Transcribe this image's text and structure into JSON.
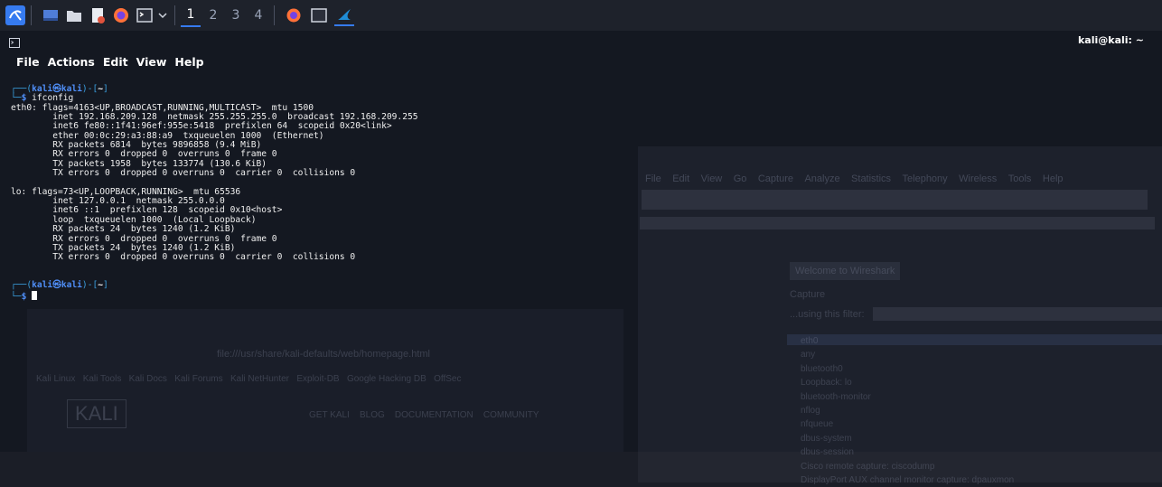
{
  "taskbar": {
    "workspaces": [
      "1",
      "2",
      "3",
      "4"
    ],
    "active_workspace": "1",
    "accent": "#367bf0"
  },
  "window": {
    "title": "kali@kali: ~"
  },
  "menu": [
    "File",
    "Actions",
    "Edit",
    "View",
    "Help"
  ],
  "terminal": {
    "prompt_user": "kali",
    "prompt_at": "㉿",
    "prompt_host": "kali",
    "prompt_dir": "~",
    "command": "ifconfig",
    "output_lines": [
      "eth0: flags=4163<UP,BROADCAST,RUNNING,MULTICAST>  mtu 1500",
      "        inet 192.168.209.128  netmask 255.255.255.0  broadcast 192.168.209.255",
      "        inet6 fe80::1f41:96ef:955e:5418  prefixlen 64  scopeid 0x20<link>",
      "        ether 00:0c:29:a3:88:a9  txqueuelen 1000  (Ethernet)",
      "        RX packets 6814  bytes 9896858 (9.4 MiB)",
      "        RX errors 0  dropped 0  overruns 0  frame 0",
      "        TX packets 1958  bytes 133774 (130.6 KiB)",
      "        TX errors 0  dropped 0 overruns 0  carrier 0  collisions 0",
      "",
      "lo: flags=73<UP,LOOPBACK,RUNNING>  mtu 65536",
      "        inet 127.0.0.1  netmask 255.0.0.0",
      "        inet6 ::1  prefixlen 128  scopeid 0x10<host>",
      "        loop  txqueuelen 1000  (Local Loopback)",
      "        RX packets 24  bytes 1240 (1.2 KiB)",
      "        RX errors 0  dropped 0  overruns 0  frame 0",
      "        TX packets 24  bytes 1240 (1.2 KiB)",
      "        TX errors 0  dropped 0 overruns 0  carrier 0  collisions 0"
    ]
  },
  "background": {
    "wireshark_menu": [
      "File",
      "Edit",
      "View",
      "Go",
      "Capture",
      "Analyze",
      "Statistics",
      "Telephony",
      "Wireless",
      "Tools",
      "Help"
    ],
    "wireshark_welcome": "Welcome to Wireshark",
    "wireshark_capture": "Capture",
    "wireshark_filter_label": "...using this filter:",
    "wireshark_interfaces": [
      "eth0",
      "any",
      "bluetooth0",
      "Loopback: lo",
      "bluetooth-monitor",
      "nflog",
      "nfqueue",
      "dbus-system",
      "dbus-session",
      "Cisco remote capture: ciscodump",
      "DisplayPort AUX channel monitor capture: dpauxmon"
    ],
    "browser_url": "file:///usr/share/kali-defaults/web/homepage.html",
    "browser_bookmarks": [
      "Kali Linux",
      "Kali Tools",
      "Kali Docs",
      "Kali Forums",
      "Kali NetHunter",
      "Exploit-DB",
      "Google Hacking DB",
      "OffSec"
    ],
    "browser_logo": "KALI",
    "browser_nav": [
      "GET KALI",
      "BLOG",
      "DOCUMENTATION",
      "COMMUNITY"
    ]
  }
}
